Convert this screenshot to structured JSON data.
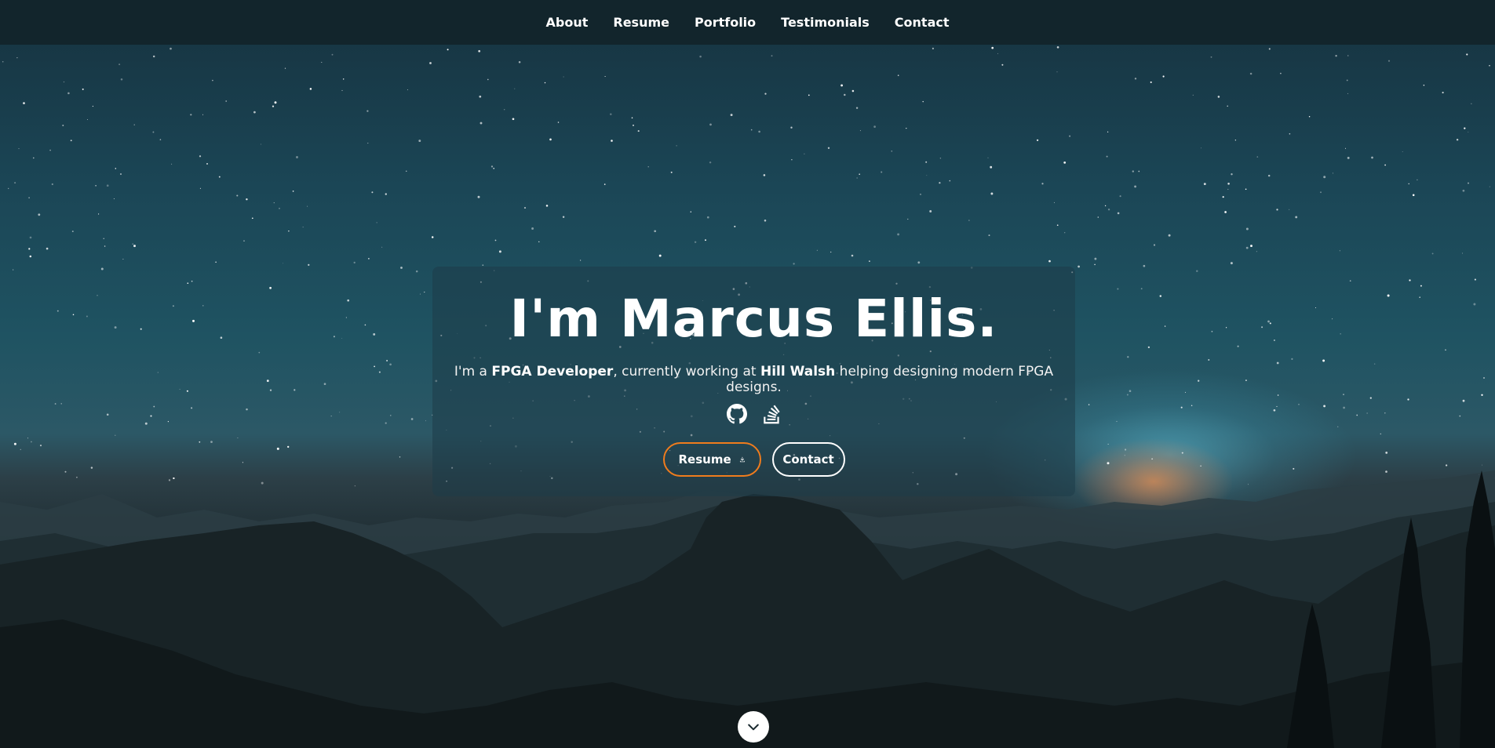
{
  "nav": {
    "items": [
      {
        "label": "About"
      },
      {
        "label": "Resume"
      },
      {
        "label": "Portfolio"
      },
      {
        "label": "Testimonials"
      },
      {
        "label": "Contact"
      }
    ]
  },
  "hero": {
    "title": "I'm Marcus Ellis.",
    "intro_prefix": "I'm a ",
    "role": "FPGA Developer",
    "intro_middle": ", currently working at ",
    "company": "Hill Walsh",
    "intro_suffix": " helping designing modern FPGA designs.",
    "socials": [
      {
        "icon": "github-icon"
      },
      {
        "icon": "stack-overflow-icon"
      }
    ],
    "buttons": {
      "resume_label": "Resume",
      "contact_label": "Contact"
    },
    "scroll_icon": "chevron-down-icon"
  },
  "colors": {
    "accent": "#f07c1d",
    "nav_bg": "#12242a",
    "text": "#ffffff"
  }
}
